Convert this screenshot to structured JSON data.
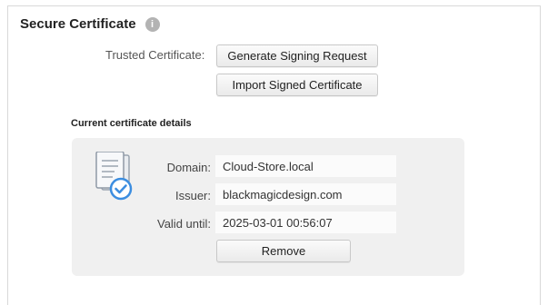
{
  "section": {
    "title": "Secure Certificate",
    "info_icon": "info-icon"
  },
  "trusted": {
    "label": "Trusted Certificate:",
    "generate_button": "Generate Signing Request",
    "import_button": "Import Signed Certificate"
  },
  "details": {
    "heading": "Current certificate details",
    "icon": "certificate-document-icon",
    "domain_label": "Domain:",
    "domain_value": "Cloud-Store.local",
    "issuer_label": "Issuer:",
    "issuer_value": "blackmagicdesign.com",
    "valid_label": "Valid until:",
    "valid_value": "2025-03-01 00:56:07",
    "remove_button": "Remove"
  },
  "colors": {
    "accent_blue": "#3b8de0",
    "card_bg": "#f0f0f0"
  }
}
